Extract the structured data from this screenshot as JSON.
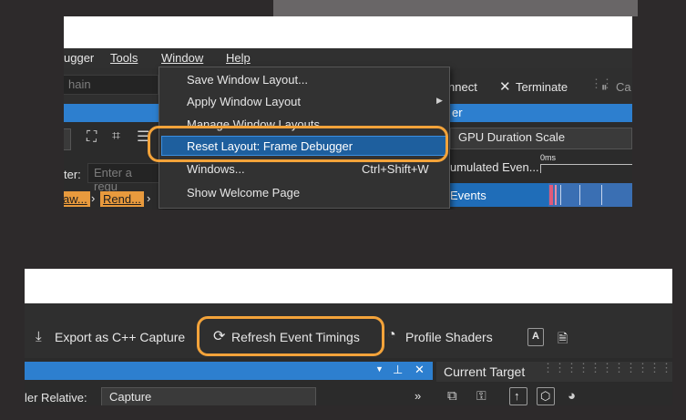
{
  "top": {
    "menubar": [
      "ugger",
      "Tools",
      "Window",
      "Help"
    ],
    "search_placeholder": "hain",
    "connect_label": "nnect",
    "terminate_label": "Terminate",
    "ca_label": "Ca",
    "panel_header": "er",
    "scale_dropdown": "GPU Duration Scale",
    "filter_label": "ter:",
    "filter_placeholder": "Enter a regu",
    "crumbs": [
      "aw...",
      "Rend..."
    ],
    "cumulated_label": "umulated Even...",
    "ms_label": "0ms",
    "events_label": "Events"
  },
  "window_menu": {
    "items": [
      {
        "label": "Save Window Layout...",
        "shortcut": ""
      },
      {
        "label": "Apply Window Layout",
        "shortcut": "",
        "submenu": true
      },
      {
        "label": "Manage Window Layouts",
        "shortcut": ""
      },
      {
        "label": "Reset Layout: Frame Debugger",
        "shortcut": "",
        "highlighted": true
      },
      {
        "label": "Windows...",
        "shortcut": "Ctrl+Shift+W"
      },
      {
        "label": "Show Welcome Page",
        "shortcut": ""
      }
    ]
  },
  "bottom": {
    "export_label": "Export as C++ Capture",
    "refresh_label": "Refresh Event Timings",
    "profile_label": "Profile Shaders",
    "current_target_label": "Current Target",
    "relative_label": "ler Relative:",
    "relative_value": "Capture",
    "chevrons": "»"
  },
  "colors": {
    "highlight_orange": "#f3a33a",
    "accent_blue": "#2d7fcf",
    "menu_selection": "#1e5f9e"
  }
}
